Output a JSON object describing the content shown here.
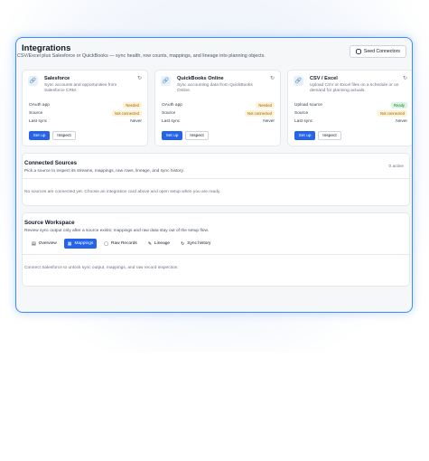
{
  "header": {
    "title": "Integrations",
    "subtitle": "CSV/Excel plus Salesforce or QuickBooks — sync health, row counts, mappings, and lineage into planning objects.",
    "seed_button": "Seed Connectors"
  },
  "cards": [
    {
      "name": "Salesforce",
      "desc": "Sync accounts and opportunities from Salesforce CRM.",
      "icon": "link-icon",
      "rows": [
        {
          "label": "OAuth app",
          "value": "Needed",
          "kind": "warn"
        },
        {
          "label": "Source",
          "value": "Not connected",
          "kind": "warn"
        },
        {
          "label": "Last sync",
          "value": "Never",
          "kind": "text"
        }
      ],
      "setup": "Set up",
      "inspect": "Inspect"
    },
    {
      "name": "QuickBooks Online",
      "desc": "Sync accounting data from QuickBooks Online.",
      "icon": "link-icon",
      "rows": [
        {
          "label": "OAuth app",
          "value": "Needed",
          "kind": "warn"
        },
        {
          "label": "Source",
          "value": "Not connected",
          "kind": "warn"
        },
        {
          "label": "Last sync",
          "value": "Never",
          "kind": "text"
        }
      ],
      "setup": "Set up",
      "inspect": "Inspect"
    },
    {
      "name": "CSV / Excel",
      "desc": "Upload CSV or Excel files on a schedule or on demand for planning actuals.",
      "icon": "link-icon",
      "rows": [
        {
          "label": "Upload source",
          "value": "Ready",
          "kind": "ok"
        },
        {
          "label": "Source",
          "value": "Not connected",
          "kind": "warn"
        },
        {
          "label": "Last sync",
          "value": "Never",
          "kind": "text"
        }
      ],
      "setup": "Set up",
      "inspect": "Inspect"
    }
  ],
  "connected": {
    "title": "Connected Sources",
    "subtitle": "Pick a source to inspect its streams, mappings, raw rows, lineage, and sync history.",
    "count": "0 active",
    "empty": "No sources are connected yet. Choose an integration card above and open setup when you are ready."
  },
  "workspace": {
    "title": "Source Workspace",
    "subtitle": "Review sync output only after a source exists; mappings and raw data stay out of the setup flow.",
    "tabs": [
      {
        "label": "Overview",
        "icon": "▤",
        "active": false
      },
      {
        "label": "Mappings",
        "icon": "▦",
        "active": true
      },
      {
        "label": "Raw Records",
        "icon": "▢",
        "active": false
      },
      {
        "label": "Lineage",
        "icon": "✎",
        "active": false
      },
      {
        "label": "Sync history",
        "icon": "↻",
        "active": false
      }
    ],
    "empty": "Connect Salesforce to unlock sync output, mappings, and raw record inspection."
  },
  "colors": {
    "accent": "#2563eb",
    "warn_bg": "#fdf3d6",
    "ok_bg": "#dcf5e3"
  }
}
